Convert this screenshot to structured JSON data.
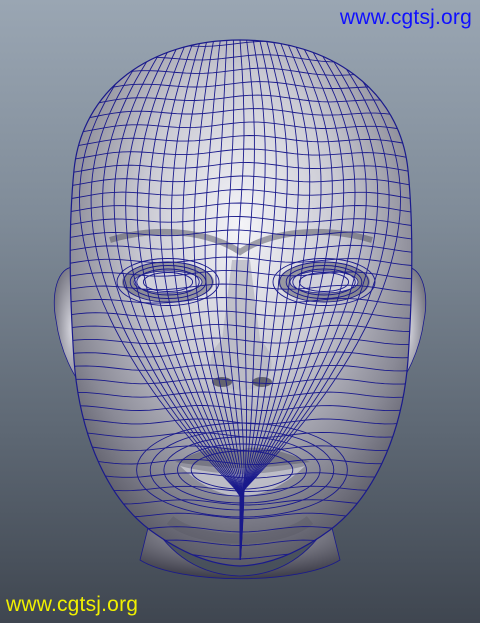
{
  "watermarks": {
    "top_right": "www.cgtsj.org",
    "bottom_left": "www.cgtsj.org"
  },
  "colors": {
    "background_top": "#9aa6b3",
    "background_bottom": "#3f4650",
    "wireframe": "#1a1a8c",
    "mesh_light": "#f2f2f6",
    "mesh_shadow": "#4a4a58",
    "watermark_top": "#1010ff",
    "watermark_bottom": "#f0f000"
  }
}
